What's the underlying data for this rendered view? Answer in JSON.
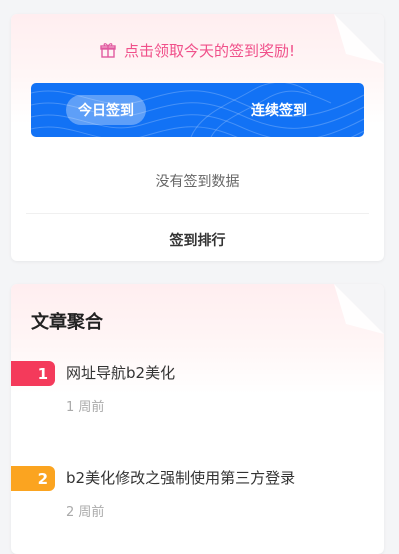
{
  "checkin": {
    "reward_text": "点击领取今天的签到奖励!",
    "today_label": "今日签到",
    "streak_label": "连续签到",
    "empty_text": "没有签到数据",
    "rank_link": "签到排行"
  },
  "articles": {
    "title": "文章聚合",
    "items": [
      {
        "rank": "1",
        "title": "网址导航b2美化",
        "time": "1 周前"
      },
      {
        "rank": "2",
        "title": "b2美化修改之强制使用第三方登录",
        "time": "2 周前"
      }
    ]
  },
  "colors": {
    "accent_pink": "#f0508a",
    "checkin_blue": "#1272f5",
    "rank1": "#f43a5b",
    "rank2": "#fba420"
  },
  "icons": {
    "reward": "gift-icon"
  }
}
